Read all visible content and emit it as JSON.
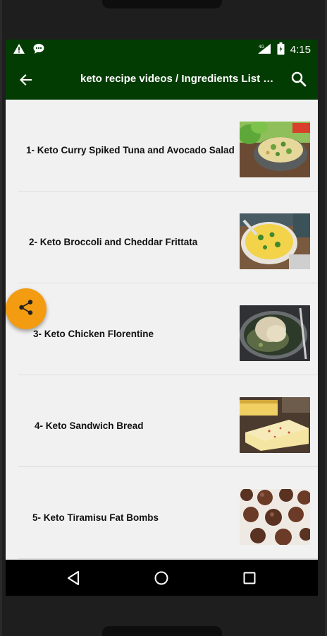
{
  "status_bar": {
    "network_label": "4G",
    "time": "4:15"
  },
  "app_bar": {
    "title": "keto recipe videos / Ingredients List Recipes"
  },
  "recipes": [
    {
      "label": "1- Keto Curry Spiked Tuna and Avocado Salad"
    },
    {
      "label": "2- Keto Broccoli and Cheddar Frittata"
    },
    {
      "label": "3- Keto Chicken Florentine"
    },
    {
      "label": "4- Keto Sandwich Bread"
    },
    {
      "label": "5- Keto Tiramisu Fat Bombs"
    }
  ],
  "icons": {
    "back": "arrow-back-icon",
    "search": "search-icon",
    "share": "share-icon",
    "nav_back": "nav-back-icon",
    "nav_home": "nav-home-icon",
    "nav_recents": "nav-recents-icon"
  },
  "colors": {
    "app_bar": "#033c03",
    "fab": "#f39c12",
    "list_background": "#f1f1f1"
  }
}
